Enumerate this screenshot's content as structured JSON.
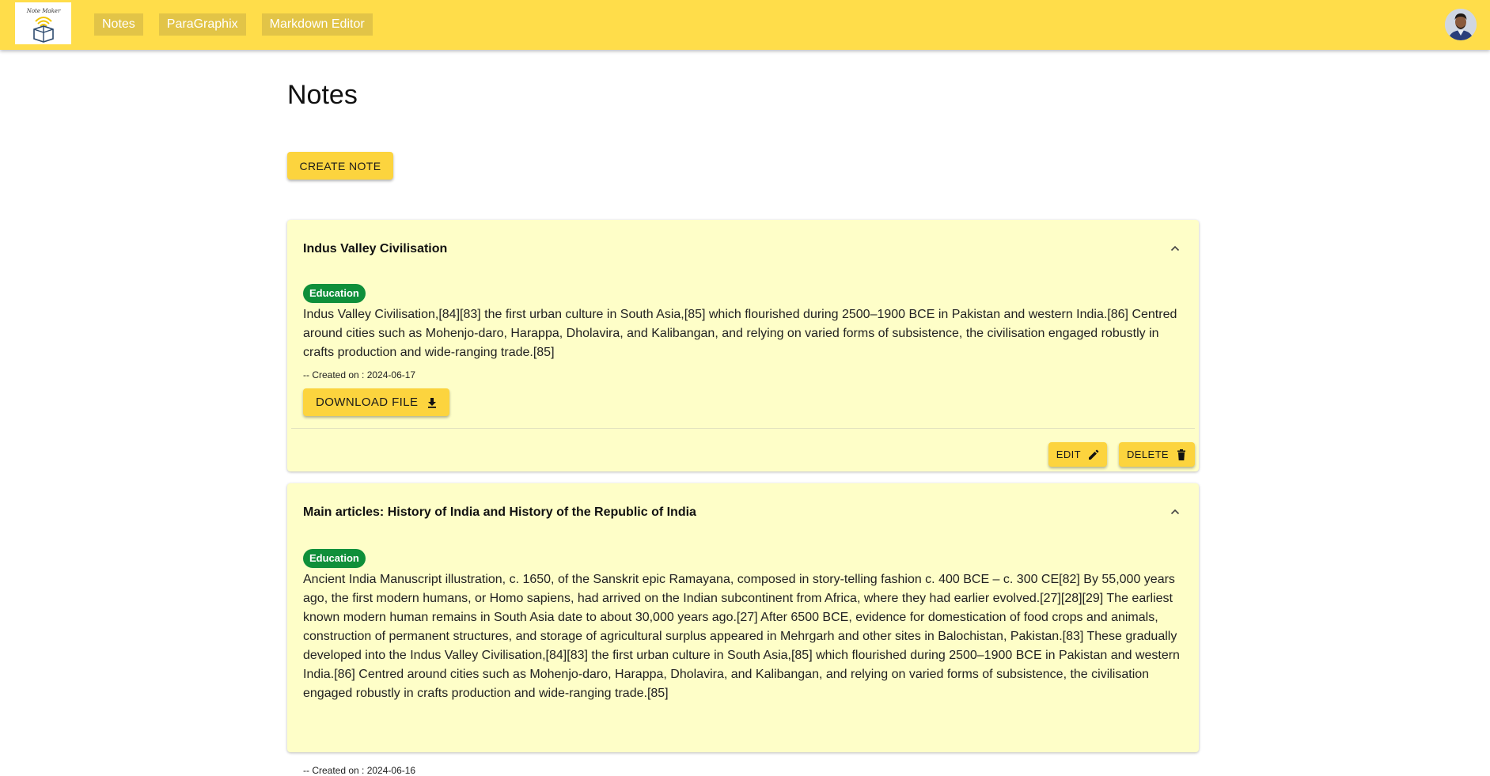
{
  "header": {
    "logo_text": "Note Maker",
    "nav": [
      {
        "label": "Notes"
      },
      {
        "label": "ParaGraphix"
      },
      {
        "label": "Markdown Editor"
      }
    ],
    "avatar_icon": "user-avatar",
    "brand_color": "#ffdd4a"
  },
  "main": {
    "title": "Notes",
    "create_label": "CREATE NOTE"
  },
  "notes": [
    {
      "title": "Indus Valley Civilisation",
      "tag": "Education",
      "description": "Indus Valley Civilisation,[84][83] the first urban culture in South Asia,[85] which flourished during 2500–1900 BCE in Pakistan and western India.[86] Centred around cities such as Mohenjo-daro, Harappa, Dholavira, and Kalibangan, and relying on varied forms of subsistence, the civilisation engaged robustly in crafts production and wide-ranging trade.[85]",
      "created": "-- Created on : 2024-06-17",
      "download_label": "DOWNLOAD FILE",
      "edit_label": "EDIT",
      "delete_label": "DELETE"
    },
    {
      "title": "Main articles: History of India and History of the Republic of India",
      "tag": "Education",
      "description": "Ancient India Manuscript illustration, c. 1650, of the Sanskrit epic Ramayana, composed in story-telling fashion c. 400 BCE – c. 300 CE[82] By 55,000 years ago, the first modern humans, or Homo sapiens, had arrived on the Indian subcontinent from Africa, where they had earlier evolved.[27][28][29] The earliest known modern human remains in South Asia date to about 30,000 years ago.[27] After 6500 BCE, evidence for domestication of food crops and animals, construction of permanent structures, and storage of agricultural surplus appeared in Mehrgarh and other sites in Balochistan, Pakistan.[83] These gradually developed into the Indus Valley Civilisation,[84][83] the first urban culture in South Asia,[85] which flourished during 2500–1900 BCE in Pakistan and western India.[86] Centred around cities such as Mohenjo-daro, Harappa, Dholavira, and Kalibangan, and relying on varied forms of subsistence, the civilisation engaged robustly in crafts production and wide-ranging trade.[85]",
      "created": "-- Created on : 2024-06-16"
    }
  ],
  "colors": {
    "card_bg": "#fefec8",
    "button_bg": "#fcd43e",
    "tag_bg": "#0f8f3a"
  }
}
